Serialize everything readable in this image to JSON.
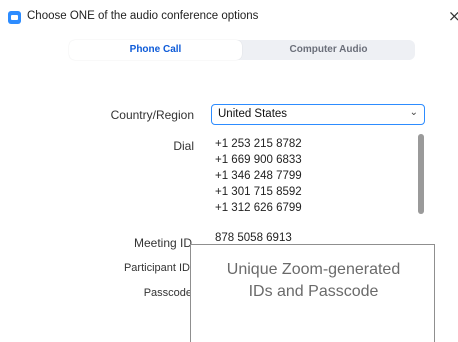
{
  "window": {
    "title": "Choose ONE of the audio conference options",
    "close_symbol": "×",
    "app_icon": "zoom-icon"
  },
  "tabs": [
    {
      "label": "Phone Call",
      "active": true
    },
    {
      "label": "Computer Audio",
      "active": false
    }
  ],
  "form": {
    "country_label": "Country/Region",
    "country_value": "United States",
    "dial_label": "Dial",
    "dial_numbers": [
      "+1 253 215 8782",
      "+1 669 900 6833",
      "+1 346 248 7799",
      "+1 301 715 8592",
      "+1 312 626 6799"
    ],
    "meeting_id_label": "Meeting ID",
    "meeting_id_value": "878 5058 6913",
    "participant_id_label": "Participant ID",
    "passcode_label": "Passcode"
  },
  "callout": {
    "line1": "Unique Zoom-generated",
    "line2": "IDs and Passcode"
  },
  "colors": {
    "accent": "#2d8cff",
    "active_tab_text": "#0e5bd8"
  }
}
